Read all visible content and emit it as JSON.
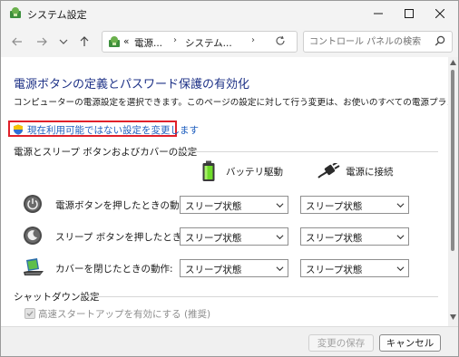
{
  "window": {
    "title": "システム設定"
  },
  "address": {
    "crumbs": [
      "電源...",
      "システム..."
    ],
    "overflow": "«",
    "separator": "›"
  },
  "search": {
    "placeholder": "コントロール パネルの検索"
  },
  "page": {
    "title": "電源ボタンの定義とパスワード保護の有効化",
    "description": "コンピューターの電源設定を選択できます。このページの設定に対して行う変更は、お使いのすべての電源プランに適用されます。",
    "change_link": "現在利用可能ではない設定を変更します"
  },
  "section_power": {
    "heading": "電源とスリープ ボタンおよびカバーの設定",
    "columns": {
      "battery": "バッテリ駆動",
      "plugged": "電源に接続"
    },
    "rows": [
      {
        "label": "電源ボタンを押したときの動作:",
        "battery": "スリープ状態",
        "plugged": "スリープ状態",
        "icon": "power-button-icon"
      },
      {
        "label": "スリープ ボタンを押したときの動作:",
        "battery": "スリープ状態",
        "plugged": "スリープ状態",
        "icon": "sleep-button-icon"
      },
      {
        "label": "カバーを閉じたときの動作:",
        "battery": "スリープ状態",
        "plugged": "スリープ状態",
        "icon": "laptop-lid-icon"
      }
    ]
  },
  "section_shutdown": {
    "heading": "シャットダウン設定",
    "fast_startup_label": "高速スタートアップを有効にする (推奨)",
    "fast_startup_checked": true
  },
  "footer": {
    "save_label": "変更の保存",
    "cancel_label": "キャンセル"
  },
  "colors": {
    "title_blue": "#1e3287",
    "link_blue": "#1f5fbf",
    "highlight_red": "#e0202a"
  }
}
